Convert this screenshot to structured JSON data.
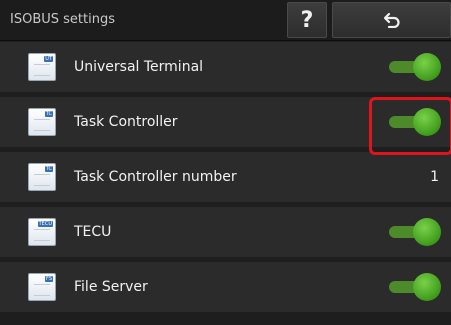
{
  "header": {
    "title": "ISOBUS settings",
    "help_label": "?",
    "back_icon": "return-arrow-icon"
  },
  "items": [
    {
      "label": "Universal Terminal",
      "icon_tag": "UT",
      "control": "toggle",
      "state": "on"
    },
    {
      "label": "Task Controller",
      "icon_tag": "TC",
      "control": "toggle",
      "state": "on"
    },
    {
      "label": "Task Controller number",
      "icon_tag": "TC",
      "control": "value",
      "value": "1"
    },
    {
      "label": "TECU",
      "icon_tag": "TECU",
      "control": "toggle",
      "state": "on"
    },
    {
      "label": "File Server",
      "icon_tag": "FS",
      "control": "toggle",
      "state": "on"
    }
  ],
  "colors": {
    "toggle_on": "#48a81e",
    "highlight": "#e0151b",
    "background": "#1e1e1e"
  }
}
